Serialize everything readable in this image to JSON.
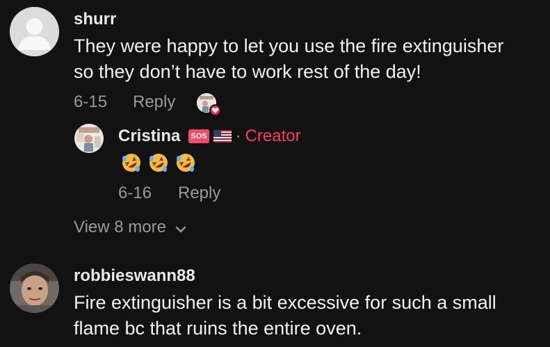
{
  "comments": [
    {
      "username": "shurr",
      "text_lines": [
        "They were happy to let you use the fire extinguisher",
        "so they don’t have to work rest of the day!"
      ],
      "date": "6-15",
      "reply_label": "Reply",
      "liked_by_creator": true,
      "replies": [
        {
          "username": "Cristina",
          "badges": [
            "SOS",
            "us-flag"
          ],
          "separator": "·",
          "role_label": "Creator",
          "emojis": [
            "rolling-on-floor-laughing",
            "rolling-on-floor-laughing",
            "rolling-on-floor-laughing"
          ],
          "date": "6-16",
          "reply_label": "Reply"
        }
      ],
      "view_more_label": "View 8 more"
    },
    {
      "username": "robbieswann88",
      "text_lines": [
        "Fire extinguisher is a bit excessive for such a small",
        "flame bc that ruins the entire oven."
      ]
    }
  ],
  "colors": {
    "background": "#121212",
    "creator": "#ff3b5c",
    "muted": "#9a9a9a"
  }
}
